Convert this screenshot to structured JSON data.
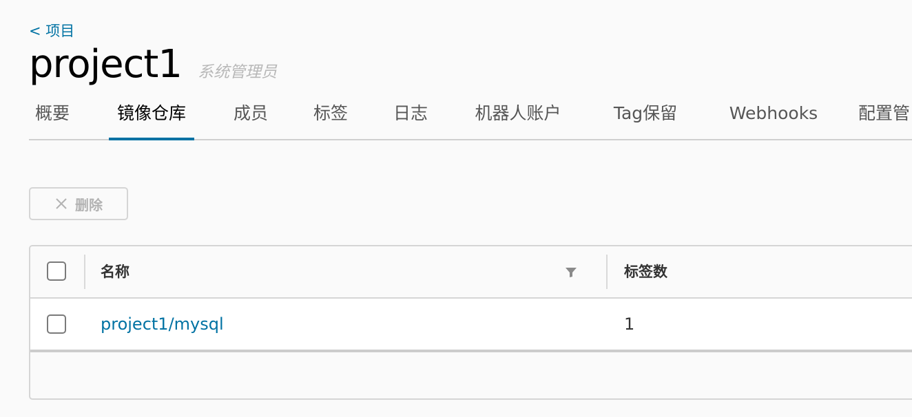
{
  "breadcrumb": {
    "back_label": "< 项目"
  },
  "header": {
    "title": "project1",
    "role": "系统管理员"
  },
  "tabs": [
    {
      "label": "概要",
      "active": false
    },
    {
      "label": "镜像仓库",
      "active": true
    },
    {
      "label": "成员",
      "active": false
    },
    {
      "label": "标签",
      "active": false
    },
    {
      "label": "日志",
      "active": false
    },
    {
      "label": "机器人账户",
      "active": false
    },
    {
      "label": "Tag保留",
      "active": false
    },
    {
      "label": "Webhooks",
      "active": false
    },
    {
      "label": "配置管",
      "active": false
    }
  ],
  "toolbar": {
    "delete_label": "删除",
    "delete_enabled": false
  },
  "table": {
    "columns": [
      "名称",
      "标签数"
    ],
    "rows": [
      {
        "name": "project1/mysql",
        "tag_count": "1",
        "selected": false
      }
    ]
  },
  "colors": {
    "accent": "#0072a3",
    "disabled": "#b3b3b3"
  }
}
